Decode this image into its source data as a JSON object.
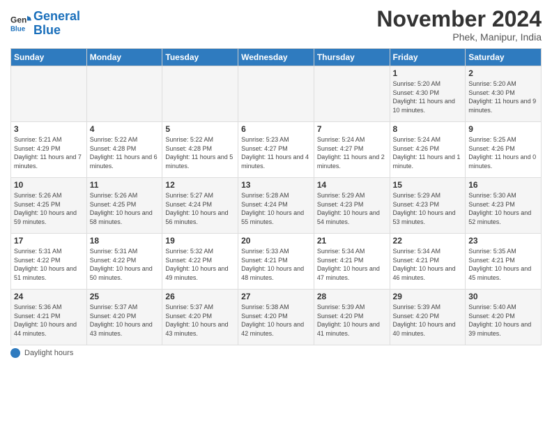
{
  "logo": {
    "line1": "General",
    "line2": "Blue"
  },
  "title": "November 2024",
  "subtitle": "Phek, Manipur, India",
  "days_of_week": [
    "Sunday",
    "Monday",
    "Tuesday",
    "Wednesday",
    "Thursday",
    "Friday",
    "Saturday"
  ],
  "weeks": [
    [
      {
        "num": "",
        "info": ""
      },
      {
        "num": "",
        "info": ""
      },
      {
        "num": "",
        "info": ""
      },
      {
        "num": "",
        "info": ""
      },
      {
        "num": "",
        "info": ""
      },
      {
        "num": "1",
        "info": "Sunrise: 5:20 AM\nSunset: 4:30 PM\nDaylight: 11 hours and 10 minutes."
      },
      {
        "num": "2",
        "info": "Sunrise: 5:20 AM\nSunset: 4:30 PM\nDaylight: 11 hours and 9 minutes."
      }
    ],
    [
      {
        "num": "3",
        "info": "Sunrise: 5:21 AM\nSunset: 4:29 PM\nDaylight: 11 hours and 7 minutes."
      },
      {
        "num": "4",
        "info": "Sunrise: 5:22 AM\nSunset: 4:28 PM\nDaylight: 11 hours and 6 minutes."
      },
      {
        "num": "5",
        "info": "Sunrise: 5:22 AM\nSunset: 4:28 PM\nDaylight: 11 hours and 5 minutes."
      },
      {
        "num": "6",
        "info": "Sunrise: 5:23 AM\nSunset: 4:27 PM\nDaylight: 11 hours and 4 minutes."
      },
      {
        "num": "7",
        "info": "Sunrise: 5:24 AM\nSunset: 4:27 PM\nDaylight: 11 hours and 2 minutes."
      },
      {
        "num": "8",
        "info": "Sunrise: 5:24 AM\nSunset: 4:26 PM\nDaylight: 11 hours and 1 minute."
      },
      {
        "num": "9",
        "info": "Sunrise: 5:25 AM\nSunset: 4:26 PM\nDaylight: 11 hours and 0 minutes."
      }
    ],
    [
      {
        "num": "10",
        "info": "Sunrise: 5:26 AM\nSunset: 4:25 PM\nDaylight: 10 hours and 59 minutes."
      },
      {
        "num": "11",
        "info": "Sunrise: 5:26 AM\nSunset: 4:25 PM\nDaylight: 10 hours and 58 minutes."
      },
      {
        "num": "12",
        "info": "Sunrise: 5:27 AM\nSunset: 4:24 PM\nDaylight: 10 hours and 56 minutes."
      },
      {
        "num": "13",
        "info": "Sunrise: 5:28 AM\nSunset: 4:24 PM\nDaylight: 10 hours and 55 minutes."
      },
      {
        "num": "14",
        "info": "Sunrise: 5:29 AM\nSunset: 4:23 PM\nDaylight: 10 hours and 54 minutes."
      },
      {
        "num": "15",
        "info": "Sunrise: 5:29 AM\nSunset: 4:23 PM\nDaylight: 10 hours and 53 minutes."
      },
      {
        "num": "16",
        "info": "Sunrise: 5:30 AM\nSunset: 4:23 PM\nDaylight: 10 hours and 52 minutes."
      }
    ],
    [
      {
        "num": "17",
        "info": "Sunrise: 5:31 AM\nSunset: 4:22 PM\nDaylight: 10 hours and 51 minutes."
      },
      {
        "num": "18",
        "info": "Sunrise: 5:31 AM\nSunset: 4:22 PM\nDaylight: 10 hours and 50 minutes."
      },
      {
        "num": "19",
        "info": "Sunrise: 5:32 AM\nSunset: 4:22 PM\nDaylight: 10 hours and 49 minutes."
      },
      {
        "num": "20",
        "info": "Sunrise: 5:33 AM\nSunset: 4:21 PM\nDaylight: 10 hours and 48 minutes."
      },
      {
        "num": "21",
        "info": "Sunrise: 5:34 AM\nSunset: 4:21 PM\nDaylight: 10 hours and 47 minutes."
      },
      {
        "num": "22",
        "info": "Sunrise: 5:34 AM\nSunset: 4:21 PM\nDaylight: 10 hours and 46 minutes."
      },
      {
        "num": "23",
        "info": "Sunrise: 5:35 AM\nSunset: 4:21 PM\nDaylight: 10 hours and 45 minutes."
      }
    ],
    [
      {
        "num": "24",
        "info": "Sunrise: 5:36 AM\nSunset: 4:21 PM\nDaylight: 10 hours and 44 minutes."
      },
      {
        "num": "25",
        "info": "Sunrise: 5:37 AM\nSunset: 4:20 PM\nDaylight: 10 hours and 43 minutes."
      },
      {
        "num": "26",
        "info": "Sunrise: 5:37 AM\nSunset: 4:20 PM\nDaylight: 10 hours and 43 minutes."
      },
      {
        "num": "27",
        "info": "Sunrise: 5:38 AM\nSunset: 4:20 PM\nDaylight: 10 hours and 42 minutes."
      },
      {
        "num": "28",
        "info": "Sunrise: 5:39 AM\nSunset: 4:20 PM\nDaylight: 10 hours and 41 minutes."
      },
      {
        "num": "29",
        "info": "Sunrise: 5:39 AM\nSunset: 4:20 PM\nDaylight: 10 hours and 40 minutes."
      },
      {
        "num": "30",
        "info": "Sunrise: 5:40 AM\nSunset: 4:20 PM\nDaylight: 10 hours and 39 minutes."
      }
    ]
  ],
  "footer": {
    "dot_label": "Daylight hours"
  }
}
